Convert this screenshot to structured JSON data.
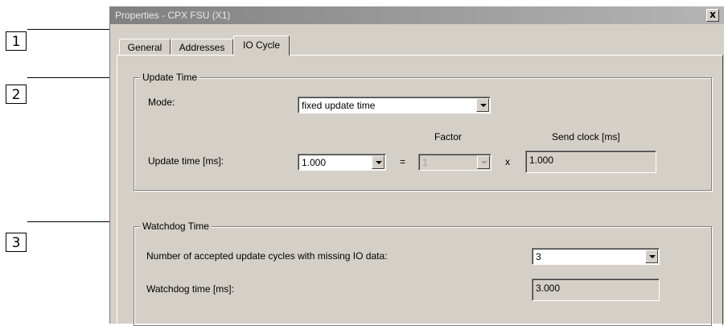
{
  "callouts": [
    "1",
    "2",
    "3"
  ],
  "window": {
    "title": "Properties - CPX FSU (X1)",
    "close_glyph": "x"
  },
  "tabs": [
    {
      "label": "General",
      "active": false
    },
    {
      "label": "Addresses",
      "active": false
    },
    {
      "label": "IO Cycle",
      "active": true
    }
  ],
  "update_time": {
    "group_title": "Update Time",
    "mode_label": "Mode:",
    "mode_value": "fixed update time",
    "factor_header": "Factor",
    "send_clock_header": "Send clock [ms]",
    "update_time_label": "Update time [ms]:",
    "update_time_value": "1.000",
    "equals_sign": "=",
    "factor_value": "1",
    "times_sign": "x",
    "send_clock_value": "1.000"
  },
  "watchdog": {
    "group_title": "Watchdog Time",
    "cycles_label": "Number of accepted update cycles with missing IO data:",
    "cycles_value": "3",
    "watchdog_label": "Watchdog time [ms]:",
    "watchdog_value": "3.000"
  }
}
